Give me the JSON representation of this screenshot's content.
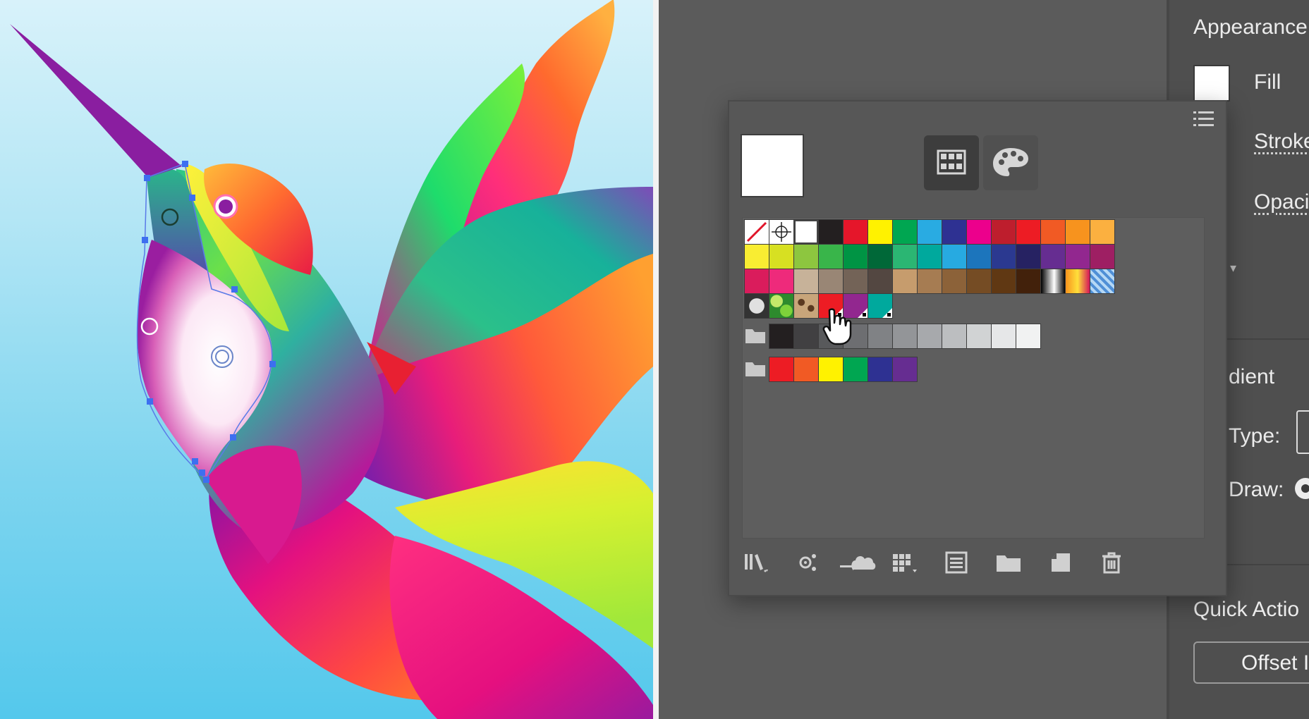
{
  "panel": {
    "appearance_title": "Appearance",
    "fill_label": "Fill",
    "stroke_label": "Stroke",
    "opacity_label": "Opaci",
    "gradient_title": "dient",
    "type_label": "Type:",
    "draw_label": "Draw:",
    "quick_actions_title": "Quick Actio",
    "offset_button_label": "Offset I"
  },
  "swatches_popup": {
    "current_fill_color": "#ffffff",
    "view_buttons": [
      "grid-view-icon",
      "palette-icon"
    ],
    "rows": [
      [
        "none",
        "registration",
        "#ffffff",
        "#231f20",
        "#e5162a",
        "#fff200",
        "#00a651",
        "#29abe2",
        "#2e3192",
        "#ec008c",
        "#be1e2d",
        "#ed1c24",
        "#f15a24",
        "#f7931e",
        "#fbb040"
      ],
      [
        "#f9ed32",
        "#d7e022",
        "#8dc63f",
        "#39b54a",
        "#009444",
        "#006838",
        "#2bb673",
        "#00a99d",
        "#27aae1",
        "#1c75bc",
        "#2b3990",
        "#262262",
        "#662d91",
        "#92278f",
        "#9e1f63"
      ],
      [
        "#da1c5c",
        "#ee2a7b",
        "#c7b299",
        "#998675",
        "#736357",
        "#534741",
        "#c69c6d",
        "#a67c52",
        "#8c6239",
        "#754c24",
        "#603813",
        "#42210b",
        "gradient-bw",
        "gradient-orange",
        "gradient-blue"
      ],
      [
        "pattern-dots",
        "pattern-leaves",
        "pattern-leopard",
        "#ed1c24",
        "#92278f",
        "#00a99d"
      ]
    ],
    "groups": [
      {
        "icon": "folder-icon",
        "colors": [
          "#231f20",
          "#414042",
          "#58595b",
          "#6d6e71",
          "#808285",
          "#939598",
          "#a7a9ac",
          "#bcbec0",
          "#d1d3d4",
          "#e6e7e8",
          "#f1f2f2"
        ]
      },
      {
        "icon": "folder-icon",
        "colors": [
          "#ed1c24",
          "#f15a24",
          "#fff200",
          "#00a651",
          "#2e3192",
          "#662d91"
        ]
      }
    ],
    "toolbar": [
      "libraries-icon",
      "show-kinds-icon",
      "cloud-sync-icon",
      "swatch-options-icon",
      "list-icon",
      "new-group-icon",
      "new-swatch-icon",
      "delete-icon"
    ]
  }
}
